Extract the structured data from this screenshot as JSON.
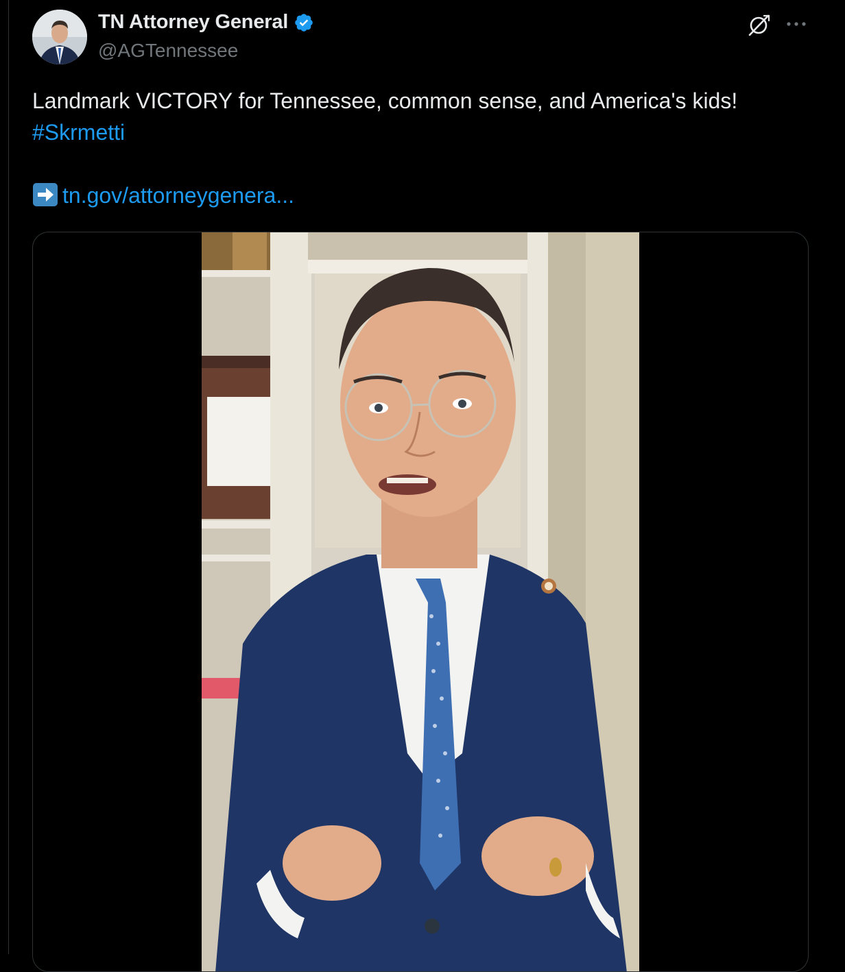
{
  "author": {
    "display_name": "TN Attorney General",
    "handle": "@AGTennessee",
    "verified": true,
    "verified_color": "#1d9bf0"
  },
  "icons": {
    "header_right": [
      "grok-icon",
      "more-icon"
    ],
    "link_prefix": "right-arrow-emoji-icon"
  },
  "tweet": {
    "text_line1": "Landmark VICTORY for Tennessee, common sense, and America's kids!",
    "hashtag": "#Skrmetti",
    "link_text": "tn.gov/attorneygenera..."
  },
  "media": {
    "type": "video"
  },
  "colors": {
    "background": "#000000",
    "text_primary": "#e7e9ea",
    "text_secondary": "#71767b",
    "link": "#1d9bf0",
    "border": "#2f3336"
  }
}
